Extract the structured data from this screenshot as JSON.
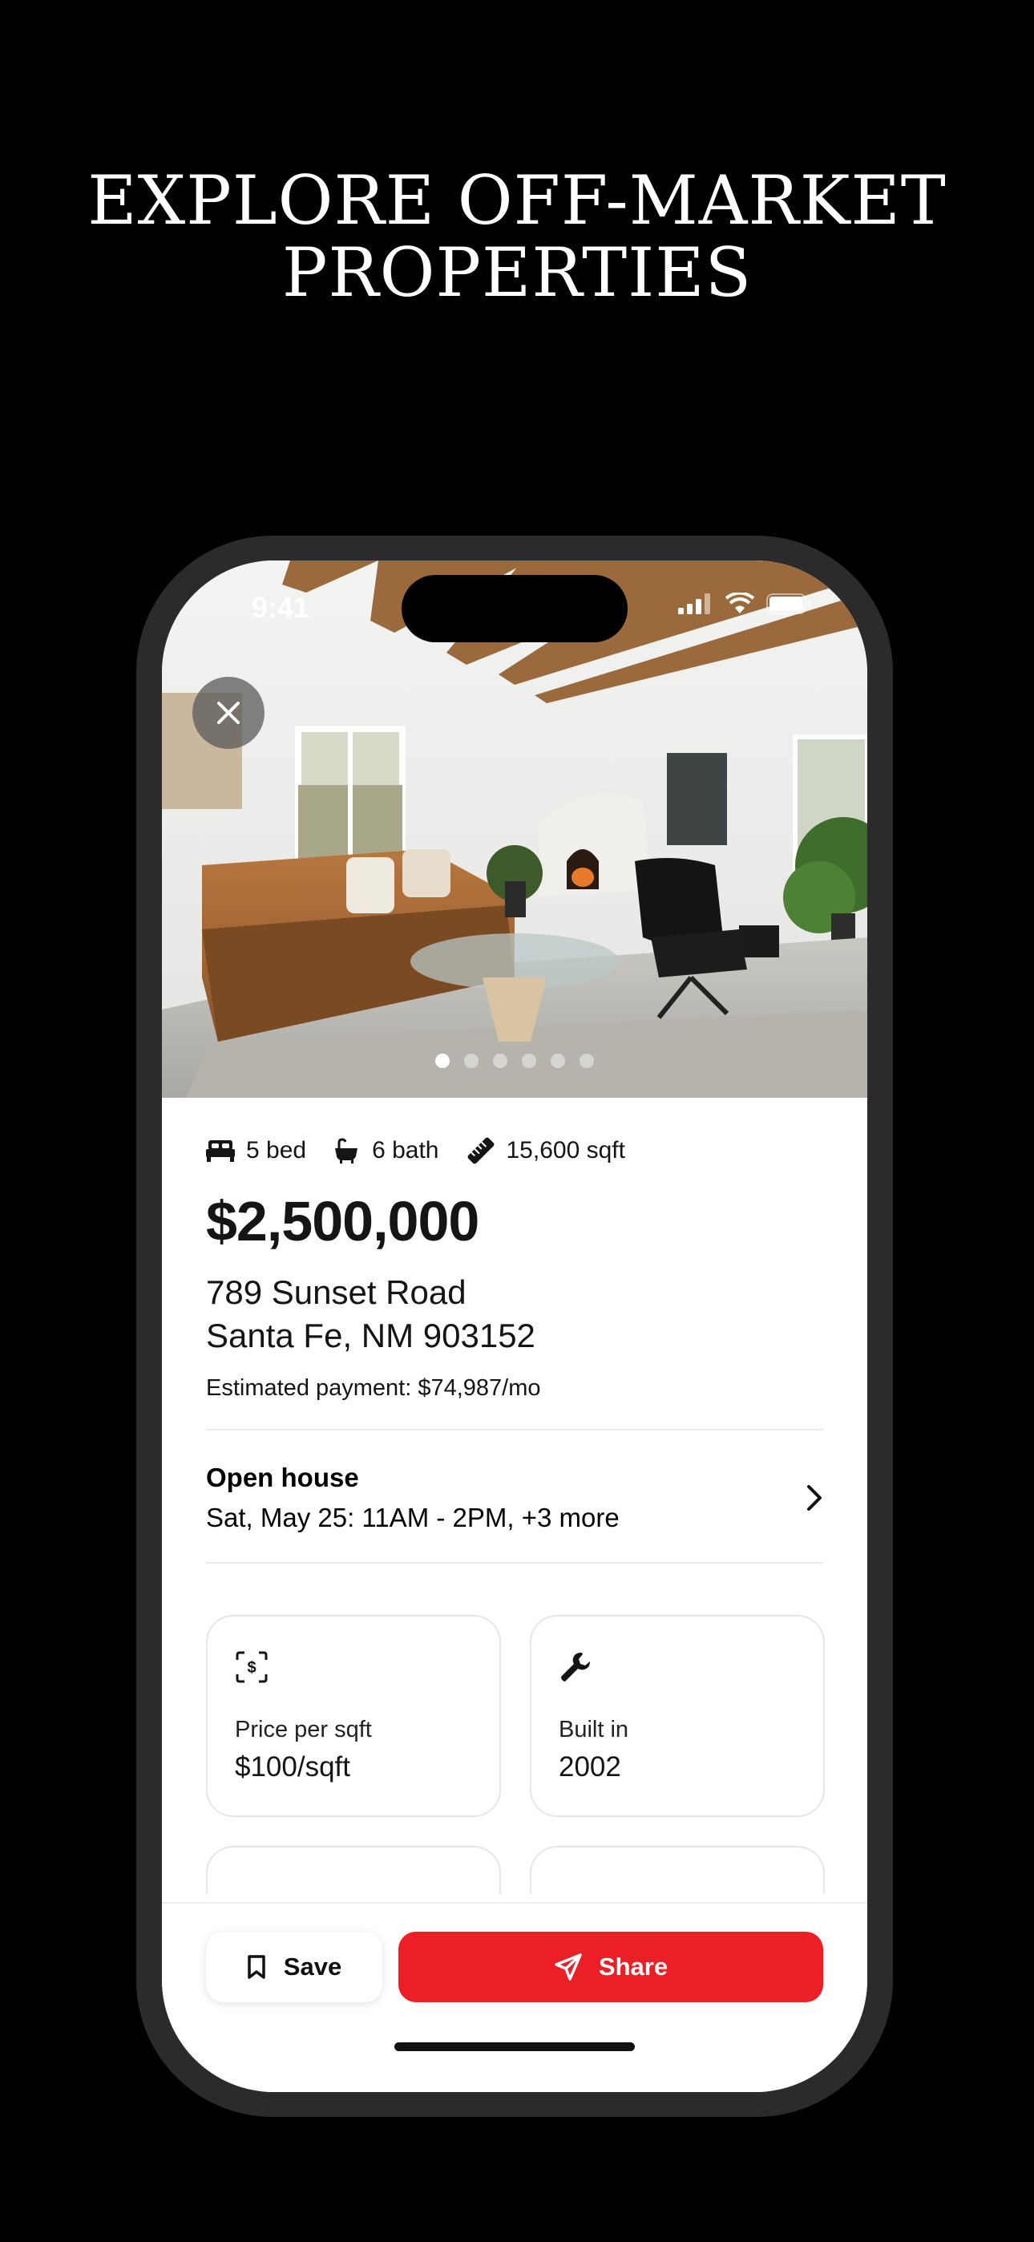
{
  "headline": {
    "line1": "EXPLORE OFF-MARKET",
    "line2": "PROPERTIES"
  },
  "status_bar": {
    "time": "9:41"
  },
  "gallery": {
    "photo_count": 6,
    "active_index": 0,
    "close_icon": "close-icon"
  },
  "listing": {
    "beds": "5 bed",
    "baths": "6 bath",
    "area": "15,600 sqft",
    "price": "$2,500,000",
    "address_line1": "789 Sunset Road",
    "address_line2": "Santa Fe, NM 903152",
    "estimated_payment": "Estimated payment: $74,987/mo"
  },
  "open_house": {
    "title": "Open house",
    "schedule": "Sat, May 25: 11AM - 2PM, +3 more"
  },
  "facts": [
    {
      "icon": "dollar-scan-icon",
      "label": "Price per sqft",
      "value": "$100/sqft"
    },
    {
      "icon": "wrench-icon",
      "label": "Built in",
      "value": "2002"
    }
  ],
  "actions": {
    "save_label": "Save",
    "share_label": "Share"
  },
  "colors": {
    "accent": "#ec1f26",
    "background": "#000000",
    "text": "#151515"
  }
}
